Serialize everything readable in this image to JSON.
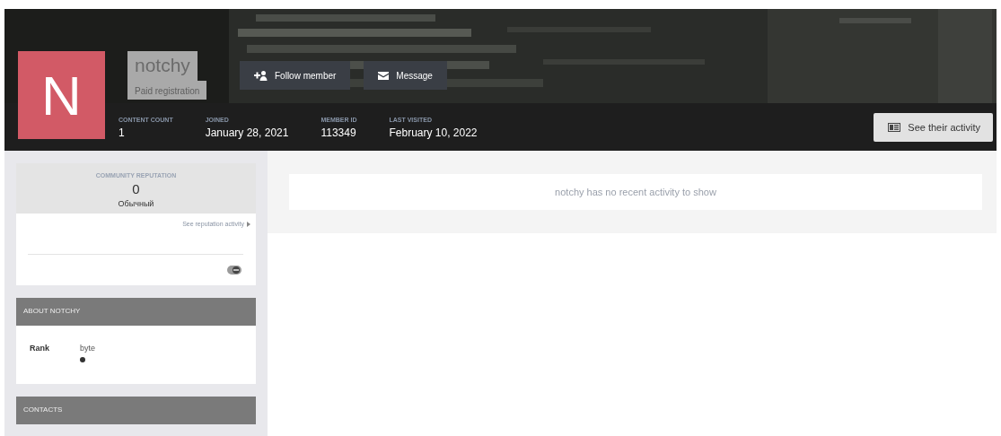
{
  "profile": {
    "avatar_letter": "N",
    "name": "notchy",
    "group": "Paid registration"
  },
  "actions": [
    {
      "kind": "follow",
      "label": "Follow member"
    },
    {
      "kind": "message",
      "label": "Message"
    }
  ],
  "stats": [
    {
      "label": "CONTENT COUNT",
      "value": "1"
    },
    {
      "label": "JOINED",
      "value": "January 28, 2021"
    },
    {
      "label": "MEMBER ID",
      "value": "113349"
    },
    {
      "label": "LAST VISITED",
      "value": "February 10, 2022"
    }
  ],
  "activity_button": "See their activity",
  "reputation": {
    "title": "COMMUNITY REPUTATION",
    "value": "0",
    "level_name": "Обычный",
    "link": "See reputation activity"
  },
  "about": {
    "title": "ABOUT NOTCHY",
    "fields": [
      {
        "label": "Rank",
        "value": "byte"
      }
    ]
  },
  "contacts": {
    "title": "CONTACTS"
  },
  "empty_activity": "notchy has no recent activity to show"
}
